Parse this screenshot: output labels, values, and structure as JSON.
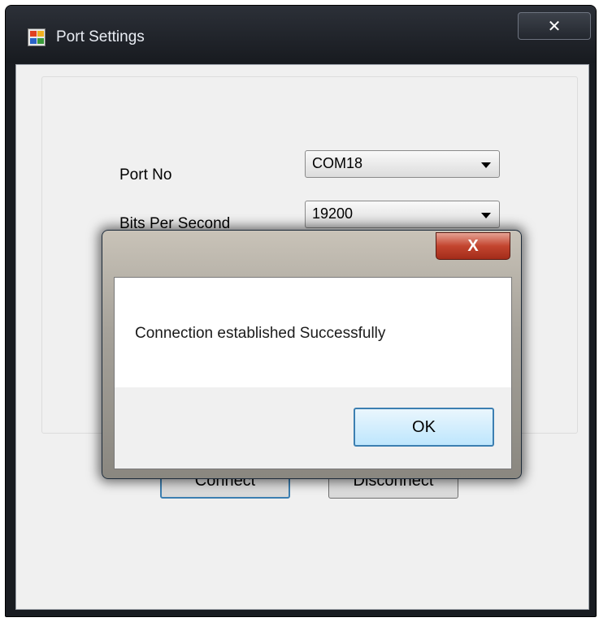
{
  "window": {
    "title": "Port Settings",
    "close_glyph": "✕"
  },
  "form": {
    "port_label": "Port No",
    "port_value": "COM18",
    "bps_label": "Bits Per Second",
    "bps_value": "19200",
    "connect_label": "Connect",
    "disconnect_label": "Disconnect"
  },
  "dialog": {
    "close_glyph": "X",
    "message": "Connection established Successfully",
    "ok_label": "OK"
  },
  "colors": {
    "titlebar": "#1e2126",
    "dialog_close": "#c3452f",
    "focus_border": "#3c7fb1"
  }
}
